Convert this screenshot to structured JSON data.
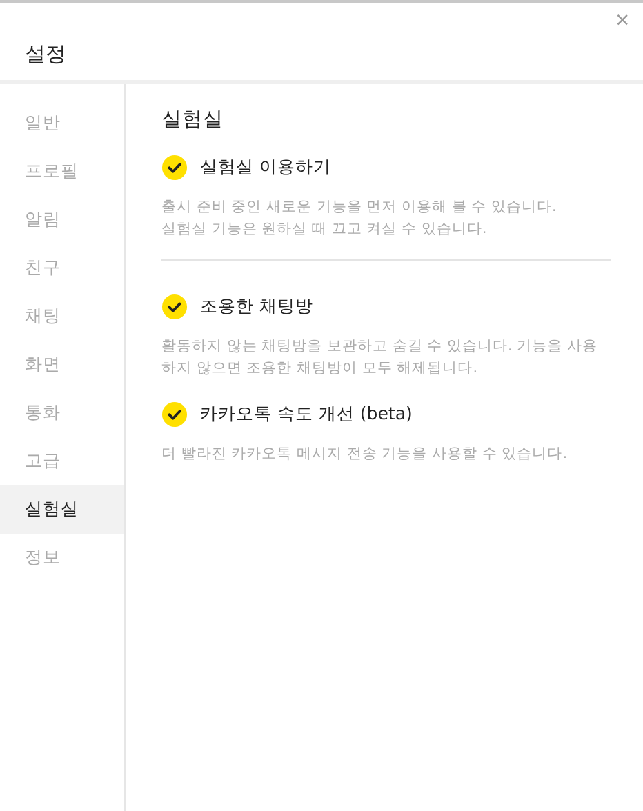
{
  "window": {
    "title": "설정",
    "close": "×"
  },
  "sidebar": {
    "items": [
      {
        "label": "일반",
        "selected": false
      },
      {
        "label": "프로필",
        "selected": false
      },
      {
        "label": "알림",
        "selected": false
      },
      {
        "label": "친구",
        "selected": false
      },
      {
        "label": "채팅",
        "selected": false
      },
      {
        "label": "화면",
        "selected": false
      },
      {
        "label": "통화",
        "selected": false
      },
      {
        "label": "고급",
        "selected": false
      },
      {
        "label": "실험실",
        "selected": true
      },
      {
        "label": "정보",
        "selected": false
      }
    ]
  },
  "content": {
    "heading": "실험실",
    "groups": [
      {
        "options": [
          {
            "label": "실험실 이용하기",
            "checked": true,
            "description": [
              "출시 준비 중인 새로운 기능을 먼저 이용해 볼 수 있습니다.",
              "실험실 기능은 원하실 때 끄고 켜실 수 있습니다."
            ]
          }
        ]
      },
      {
        "options": [
          {
            "label": "조용한 채팅방",
            "checked": true,
            "description": [
              "활동하지 않는 채팅방을 보관하고 숨길 수 있습니다. 기능을 사용",
              "하지 않으면 조용한 채팅방이 모두 해제됩니다."
            ]
          },
          {
            "label": "카카오톡 속도 개선 (beta)",
            "checked": true,
            "description": [
              "더 빨라진 카카오톡 메시지 전송 기능을 사용할 수 있습니다."
            ]
          }
        ]
      }
    ]
  }
}
